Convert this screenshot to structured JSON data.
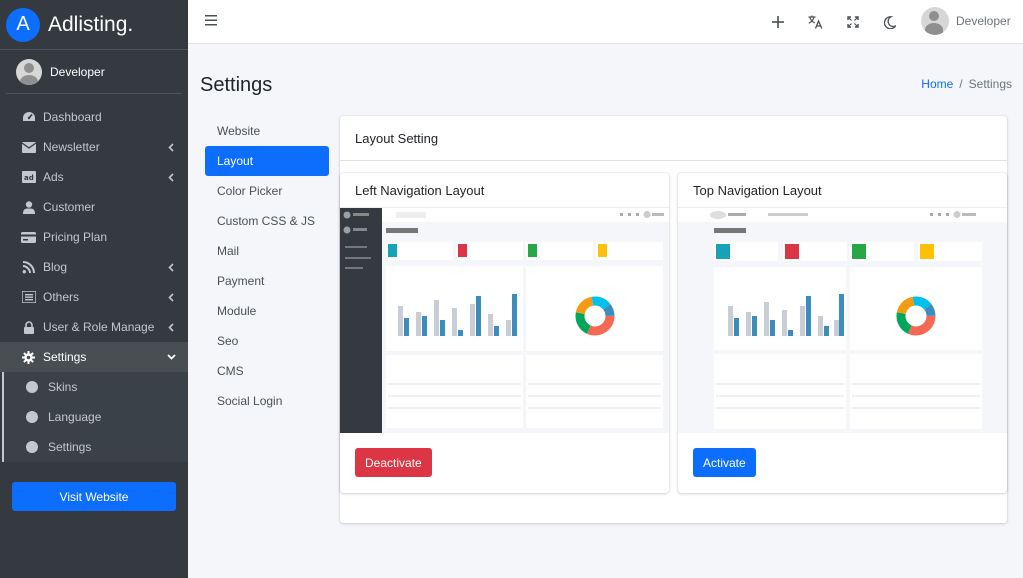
{
  "brand": {
    "logo_letter": "A",
    "name": "Adlisting."
  },
  "user": {
    "name": "Developer"
  },
  "sidebar": {
    "items": [
      {
        "label": "Dashboard",
        "icon": "dashboard-icon",
        "has_arrow": false
      },
      {
        "label": "Newsletter",
        "icon": "envelope-icon",
        "has_arrow": true
      },
      {
        "label": "Ads",
        "icon": "ad-icon",
        "has_arrow": true
      },
      {
        "label": "Customer",
        "icon": "user-icon",
        "has_arrow": false
      },
      {
        "label": "Pricing Plan",
        "icon": "credit-card-icon",
        "has_arrow": false
      },
      {
        "label": "Blog",
        "icon": "blog-icon",
        "has_arrow": true
      },
      {
        "label": "Others",
        "icon": "list-icon",
        "has_arrow": true
      },
      {
        "label": "User & Role Manage",
        "icon": "lock-icon",
        "has_arrow": true
      },
      {
        "label": "Settings",
        "icon": "gear-icon",
        "has_arrow": true,
        "active": true
      }
    ],
    "subitems": [
      {
        "label": "Skins"
      },
      {
        "label": "Language"
      },
      {
        "label": "Settings"
      }
    ],
    "visit_label": "Visit Website"
  },
  "topbar": {
    "user_name": "Developer"
  },
  "page": {
    "title": "Settings"
  },
  "breadcrumb": {
    "home": "Home",
    "separator": "/",
    "current": "Settings"
  },
  "settings_menu": [
    {
      "label": "Website"
    },
    {
      "label": "Layout",
      "active": true
    },
    {
      "label": "Color Picker"
    },
    {
      "label": "Custom CSS & JS"
    },
    {
      "label": "Mail"
    },
    {
      "label": "Payment"
    },
    {
      "label": "Module"
    },
    {
      "label": "Seo"
    },
    {
      "label": "CMS"
    },
    {
      "label": "Social Login"
    }
  ],
  "layout_setting": {
    "title": "Layout Setting",
    "left": {
      "title": "Left Navigation Layout",
      "button": "Deactivate"
    },
    "top": {
      "title": "Top Navigation Layout",
      "button": "Activate"
    }
  },
  "colors": {
    "accent": "#0d6efd",
    "danger": "#dc3545",
    "sidebar": "#343a40"
  }
}
